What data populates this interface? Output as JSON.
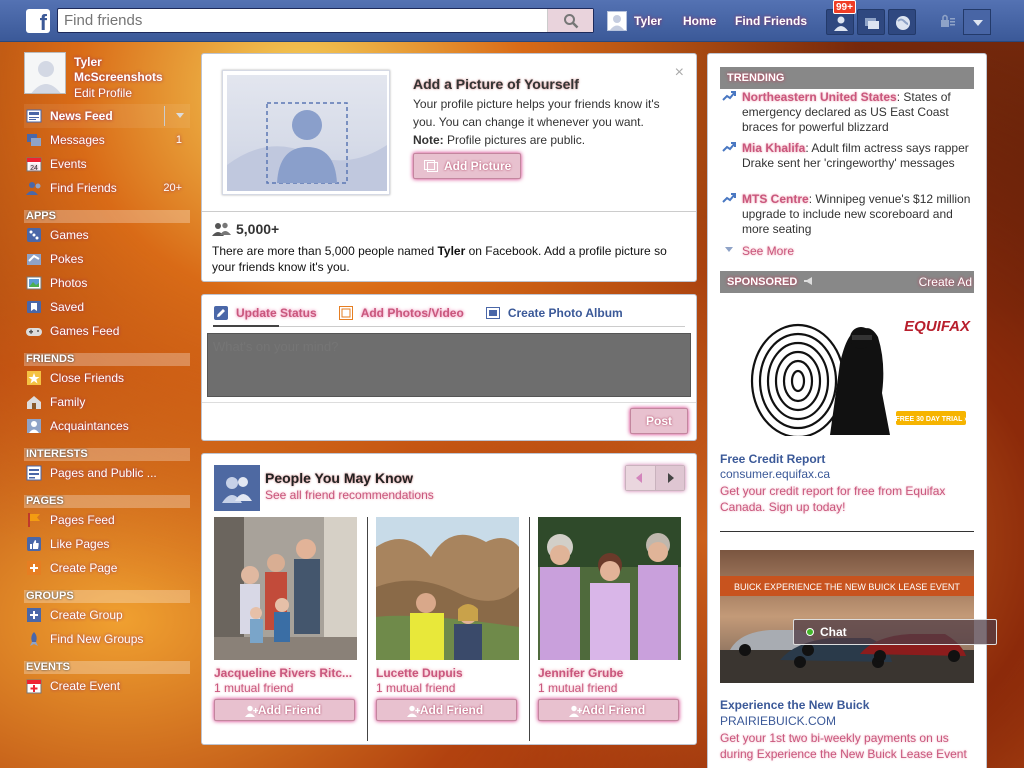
{
  "topbar": {
    "logo": "f",
    "search_placeholder": "Find friends",
    "user_name": "Tyler",
    "home": "Home",
    "find_friends": "Find Friends",
    "notification_badge": "99+"
  },
  "profile": {
    "name": "Tyler McScreenshots",
    "edit": "Edit Profile"
  },
  "sidebar": {
    "favorites": [
      {
        "label": "News Feed",
        "count": ""
      },
      {
        "label": "Messages",
        "count": "1"
      },
      {
        "label": "Events",
        "count": ""
      },
      {
        "label": "Find Friends",
        "count": "20+"
      }
    ],
    "apps_head": "APPS",
    "apps": [
      "Games",
      "Pokes",
      "Photos",
      "Saved",
      "Games Feed"
    ],
    "friends_head": "FRIENDS",
    "friends": [
      "Close Friends",
      "Family",
      "Acquaintances"
    ],
    "interests_head": "INTERESTS",
    "interests": [
      "Pages and Public ..."
    ],
    "pages_head": "PAGES",
    "pages": [
      "Pages Feed",
      "Like Pages",
      "Create Page"
    ],
    "groups_head": "GROUPS",
    "groups": [
      "Create Group",
      "Find New Groups"
    ],
    "events_head": "EVENTS",
    "events": [
      "Create Event"
    ]
  },
  "picture_card": {
    "title": "Add a Picture of Yourself",
    "desc_1": "Your profile picture helps your friends know it's you. You can change it whenever you want.",
    "note_label": "Note:",
    "note_text": " Profile pictures are public.",
    "button": "Add Picture",
    "count": "5,000+",
    "names_pre": "There are more than 5,000 people named ",
    "names_bold": "Tyler",
    "names_post": " on Facebook. Add a profile picture so your friends know it's you.",
    "close": "×"
  },
  "composer": {
    "tab_status": "Update Status",
    "tab_photos": "Add Photos/Video",
    "tab_album": "Create Photo Album",
    "placeholder": "What's on your mind?",
    "post": "Post"
  },
  "pymk": {
    "title": "People You May Know",
    "subtitle": "See all friend recommendations",
    "add_friend": "Add Friend",
    "people": [
      {
        "name": "Jacqueline Rivers Ritc...",
        "mutual": "1 mutual friend"
      },
      {
        "name": "Lucette Dupuis",
        "mutual": "1 mutual friend"
      },
      {
        "name": "Jennifer Grube",
        "mutual": "1 mutual friend"
      }
    ]
  },
  "trending": {
    "head": "TRENDING",
    "items": [
      {
        "name": "Northeastern United States",
        "text": ": States of emergency declared as US East Coast braces for powerful blizzard"
      },
      {
        "name": "Mia Khalifa",
        "text": ": Adult film actress says rapper Drake sent her 'cringeworthy' messages"
      },
      {
        "name": "MTS Centre",
        "text": ": Winnipeg venue's $12 million upgrade to include new scoreboard and more seating"
      }
    ],
    "see_more": "See More"
  },
  "sponsored": {
    "head": "SPONSORED",
    "create_ad": "Create Ad",
    "ads": [
      {
        "brand": "EQUIFAX",
        "banner": "FREE 30 DAY TRIAL ›",
        "title": "Free Credit Report",
        "domain": "consumer.equifax.ca",
        "body": "Get your credit report for free from Equifax Canada. Sign up today!"
      },
      {
        "banner": "BUICK   EXPERIENCE THE NEW BUICK LEASE EVENT",
        "title": "Experience the New Buick",
        "domain": "PRAIRIEBUICK.COM",
        "body": "Get your 1st two bi-weekly payments on us during Experience the New Buick Lease Event"
      }
    ]
  },
  "chat": {
    "label": "Chat"
  }
}
